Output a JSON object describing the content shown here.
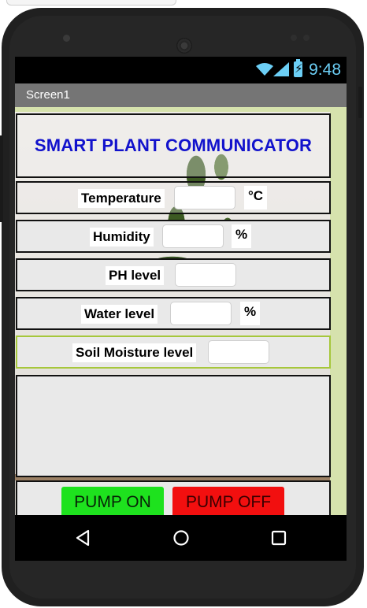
{
  "status_bar": {
    "time": "9:48"
  },
  "app": {
    "screen_title": "Screen1",
    "banner_title": "SMART PLANT COMMUNICATOR"
  },
  "sensors": [
    {
      "label": "Temperature",
      "value": "",
      "unit": "°C"
    },
    {
      "label": "Humidity",
      "value": "",
      "unit": "%"
    },
    {
      "label": "PH level",
      "value": ""
    },
    {
      "label": "Water level",
      "value": "",
      "unit": "%"
    },
    {
      "label": "Soil Moisture level",
      "value": ""
    }
  ],
  "pump": {
    "on_label": "PUMP ON",
    "off_label": "PUMP OFF"
  },
  "colors": {
    "title_blue": "#1212cc",
    "pump_on": "#1ee21e",
    "pump_off": "#f20f0f",
    "status_icons": "#6ccff6",
    "side_panel": "#d6e2ad"
  },
  "icons": {
    "status": [
      "wifi-icon",
      "cell-signal-icon",
      "battery-charging-icon"
    ],
    "navigation": [
      "back-icon",
      "home-icon",
      "recents-icon"
    ]
  }
}
